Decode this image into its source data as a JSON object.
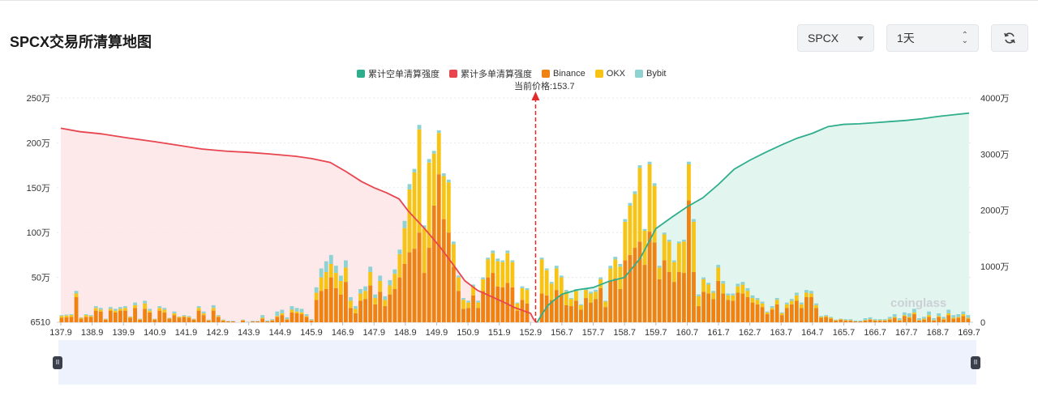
{
  "page_title": "SPCX交易所清算地图",
  "controls": {
    "symbol": "SPCX",
    "timeframe": "1天"
  },
  "legend": [
    {
      "label": "累计空单清算强度",
      "color": "#2eae8c"
    },
    {
      "label": "累计多单清算强度",
      "color": "#e8454f"
    },
    {
      "label": "Binance",
      "color": "#f08212"
    },
    {
      "label": "OKX",
      "color": "#f7c416"
    },
    {
      "label": "Bybit",
      "color": "#8fd2d2"
    }
  ],
  "current_price_label": "当前价格:153.7",
  "watermark": "coinglass",
  "chart_data": {
    "type": "bar",
    "current_price": 153.7,
    "x_tick_labels": [
      "137.9",
      "138.9",
      "139.9",
      "140.9",
      "141.9",
      "142.9",
      "143.9",
      "144.9",
      "145.9",
      "146.9",
      "147.9",
      "148.9",
      "149.9",
      "150.9",
      "151.9",
      "152.9",
      "156.7",
      "157.7",
      "158.7",
      "159.7",
      "160.7",
      "161.7",
      "162.7",
      "163.7",
      "164.7",
      "165.7",
      "166.7",
      "167.7",
      "168.7",
      "169.7"
    ],
    "y_left_ticks": [
      "250万",
      "200万",
      "150万",
      "100万",
      "50万",
      "6510"
    ],
    "y_left_values": [
      2500000,
      2000000,
      1500000,
      1000000,
      500000,
      6510
    ],
    "y_right_ticks": [
      "4000万",
      "3000万",
      "2000万",
      "1000万",
      "0"
    ],
    "y_right_values": [
      40000000,
      30000000,
      20000000,
      10000000,
      0
    ],
    "bars_binance": [
      50000,
      55000,
      60000,
      280000,
      40000,
      60000,
      60000,
      130000,
      120000,
      30000,
      130000,
      110000,
      130000,
      130000,
      50000,
      160000,
      30000,
      150000,
      110000,
      30000,
      130000,
      110000,
      40000,
      80000,
      50000,
      60000,
      50000,
      30000,
      130000,
      80000,
      20000,
      130000,
      60000,
      20000,
      10000,
      10000,
      0,
      20000,
      0,
      10000,
      10000,
      40000,
      10000,
      20000,
      60000,
      80000,
      30000,
      110000,
      100000,
      90000,
      60000,
      20000,
      250000,
      350000,
      370000,
      500000,
      380000,
      310000,
      450000,
      160000,
      100000,
      240000,
      260000,
      410000,
      200000,
      340000,
      180000,
      310000,
      370000,
      500000,
      650000,
      780000,
      820000,
      1000000,
      550000,
      830000,
      1300000,
      1650000,
      1150000,
      1000000,
      620000,
      350000,
      150000,
      160000,
      300000,
      160000,
      350000,
      500000,
      550000,
      400000,
      390000,
      440000,
      390000,
      130000,
      250000,
      210000,
      0,
      0,
      320000,
      300000,
      250000,
      360000,
      310000,
      190000,
      180000,
      240000,
      140000,
      270000,
      220000,
      260000,
      380000,
      170000,
      460000,
      490000,
      370000,
      690000,
      750000,
      830000,
      900000,
      640000,
      1010000,
      890000,
      480000,
      690000,
      560000,
      450000,
      560000,
      550000,
      1360000,
      560000,
      180000,
      340000,
      320000,
      260000,
      460000,
      320000,
      250000,
      240000,
      330000,
      320000,
      280000,
      220000,
      200000,
      170000,
      90000,
      140000,
      200000,
      80000,
      160000,
      200000,
      240000,
      160000,
      280000,
      280000,
      160000,
      50000,
      60000,
      40000,
      20000,
      30000,
      20000,
      20000,
      10000,
      10000,
      20000,
      30000,
      20000,
      20000,
      20000,
      30000,
      50000,
      20000,
      70000,
      50000,
      90000,
      20000,
      30000,
      60000,
      20000,
      60000,
      30000,
      80000,
      40000,
      50000,
      70000,
      40000
    ],
    "bars_okx": [
      20000,
      20000,
      20000,
      40000,
      10000,
      20000,
      10000,
      30000,
      20000,
      5000,
      20000,
      20000,
      20000,
      30000,
      10000,
      30000,
      5000,
      60000,
      20000,
      5000,
      30000,
      30000,
      5000,
      20000,
      10000,
      10000,
      10000,
      5000,
      30000,
      20000,
      5000,
      30000,
      10000,
      5000,
      0,
      0,
      0,
      5000,
      0,
      0,
      0,
      10000,
      0,
      5000,
      10000,
      20000,
      5000,
      30000,
      20000,
      20000,
      10000,
      5000,
      80000,
      150000,
      190000,
      150000,
      170000,
      150000,
      160000,
      80000,
      50000,
      80000,
      90000,
      150000,
      70000,
      120000,
      70000,
      100000,
      170000,
      260000,
      400000,
      700000,
      850000,
      1150000,
      500000,
      950000,
      580000,
      460000,
      480000,
      560000,
      250000,
      150000,
      100000,
      60000,
      100000,
      60000,
      130000,
      200000,
      220000,
      280000,
      280000,
      330000,
      280000,
      80000,
      130000,
      150000,
      0,
      0,
      380000,
      280000,
      180000,
      240000,
      190000,
      150000,
      80000,
      110000,
      50000,
      90000,
      100000,
      80000,
      100000,
      60000,
      140000,
      210000,
      250000,
      430000,
      550000,
      600000,
      820000,
      380000,
      750000,
      630000,
      130000,
      290000,
      340000,
      220000,
      320000,
      350000,
      400000,
      560000,
      110000,
      140000,
      100000,
      70000,
      150000,
      110000,
      50000,
      60000,
      70000,
      100000,
      70000,
      50000,
      50000,
      40000,
      20000,
      20000,
      50000,
      20000,
      40000,
      40000,
      60000,
      40000,
      50000,
      40000,
      30000,
      10000,
      10000,
      10000,
      5000,
      5000,
      5000,
      5000,
      0,
      0,
      5000,
      5000,
      5000,
      5000,
      5000,
      10000,
      10000,
      5000,
      10000,
      10000,
      20000,
      5000,
      10000,
      20000,
      5000,
      10000,
      10000,
      20000,
      10000,
      10000,
      20000,
      10000
    ],
    "bars_bybit": [
      10000,
      10000,
      10000,
      30000,
      5000,
      10000,
      10000,
      20000,
      20000,
      5000,
      20000,
      20000,
      20000,
      20000,
      5000,
      30000,
      5000,
      30000,
      20000,
      5000,
      20000,
      20000,
      5000,
      20000,
      5000,
      10000,
      10000,
      5000,
      20000,
      20000,
      5000,
      30000,
      10000,
      5000,
      5000,
      5000,
      0,
      5000,
      5000,
      5000,
      5000,
      30000,
      10000,
      10000,
      50000,
      40000,
      20000,
      40000,
      40000,
      40000,
      20000,
      10000,
      60000,
      100000,
      120000,
      100000,
      80000,
      60000,
      80000,
      40000,
      30000,
      50000,
      50000,
      60000,
      40000,
      60000,
      40000,
      60000,
      50000,
      50000,
      80000,
      60000,
      40000,
      50000,
      30000,
      40000,
      30000,
      30000,
      30000,
      30000,
      30000,
      20000,
      20000,
      20000,
      20000,
      20000,
      20000,
      20000,
      30000,
      30000,
      20000,
      30000,
      20000,
      10000,
      20000,
      20000,
      0,
      0,
      20000,
      20000,
      20000,
      30000,
      20000,
      20000,
      10000,
      20000,
      10000,
      20000,
      20000,
      20000,
      20000,
      10000,
      30000,
      30000,
      30000,
      30000,
      30000,
      30000,
      30000,
      20000,
      30000,
      30000,
      20000,
      20000,
      20000,
      20000,
      20000,
      20000,
      30000,
      30000,
      20000,
      20000,
      20000,
      20000,
      30000,
      30000,
      20000,
      20000,
      30000,
      30000,
      30000,
      30000,
      20000,
      20000,
      10000,
      20000,
      20000,
      10000,
      20000,
      20000,
      30000,
      20000,
      30000,
      30000,
      20000,
      10000,
      10000,
      10000,
      5000,
      5000,
      10000,
      10000,
      10000,
      10000,
      20000,
      20000,
      10000,
      10000,
      10000,
      20000,
      30000,
      20000,
      30000,
      40000,
      40000,
      20000,
      20000,
      40000,
      20000,
      30000,
      20000,
      40000,
      30000,
      30000,
      30000,
      30000
    ],
    "long_cum_line": {
      "x": [
        137.9,
        138.5,
        139.2,
        140.0,
        140.9,
        141.6,
        142.4,
        143.2,
        143.9,
        144.6,
        145.4,
        145.9,
        146.5,
        147.0,
        147.5,
        147.9,
        148.3,
        148.7,
        149.0,
        149.5,
        150.0,
        150.4,
        150.8,
        151.2,
        151.6,
        152.0,
        152.4,
        152.9,
        153.2,
        153.5,
        153.7
      ],
      "y": [
        34600000,
        34000000,
        33600000,
        32900000,
        32200000,
        31600000,
        30900000,
        30500000,
        30300000,
        30000000,
        29600000,
        29200000,
        28500000,
        26900000,
        25100000,
        24000000,
        23100000,
        22000000,
        19800000,
        16800000,
        13500000,
        10500000,
        7400000,
        5700000,
        4700000,
        3700000,
        2600000,
        1600000,
        700000,
        100000,
        0
      ]
    },
    "short_cum_line": {
      "x": [
        153.7,
        154.3,
        155.0,
        155.8,
        156.7,
        157.2,
        157.7,
        158.2,
        158.7,
        159.2,
        159.7,
        160.2,
        160.7,
        161.2,
        161.7,
        162.2,
        162.7,
        163.2,
        163.7,
        164.2,
        164.7,
        165.2,
        165.7,
        166.2,
        166.7,
        167.2,
        167.7,
        168.2,
        168.7,
        169.2,
        169.7
      ],
      "y": [
        0,
        1500000,
        3000000,
        4000000,
        5000000,
        5800000,
        6200000,
        7300000,
        8000000,
        11400000,
        16700000,
        18700000,
        20600000,
        22200000,
        24600000,
        27300000,
        28900000,
        30300000,
        31600000,
        32800000,
        33700000,
        34900000,
        35300000,
        35400000,
        35600000,
        35800000,
        36000000,
        36300000,
        36700000,
        37000000,
        37300000
      ]
    },
    "x_range": [
      137.9,
      169.7
    ],
    "y_left_range": [
      6510,
      2500000
    ],
    "y_right_range": [
      0,
      40000000
    ],
    "grid": true,
    "legend_position": "top-center"
  }
}
